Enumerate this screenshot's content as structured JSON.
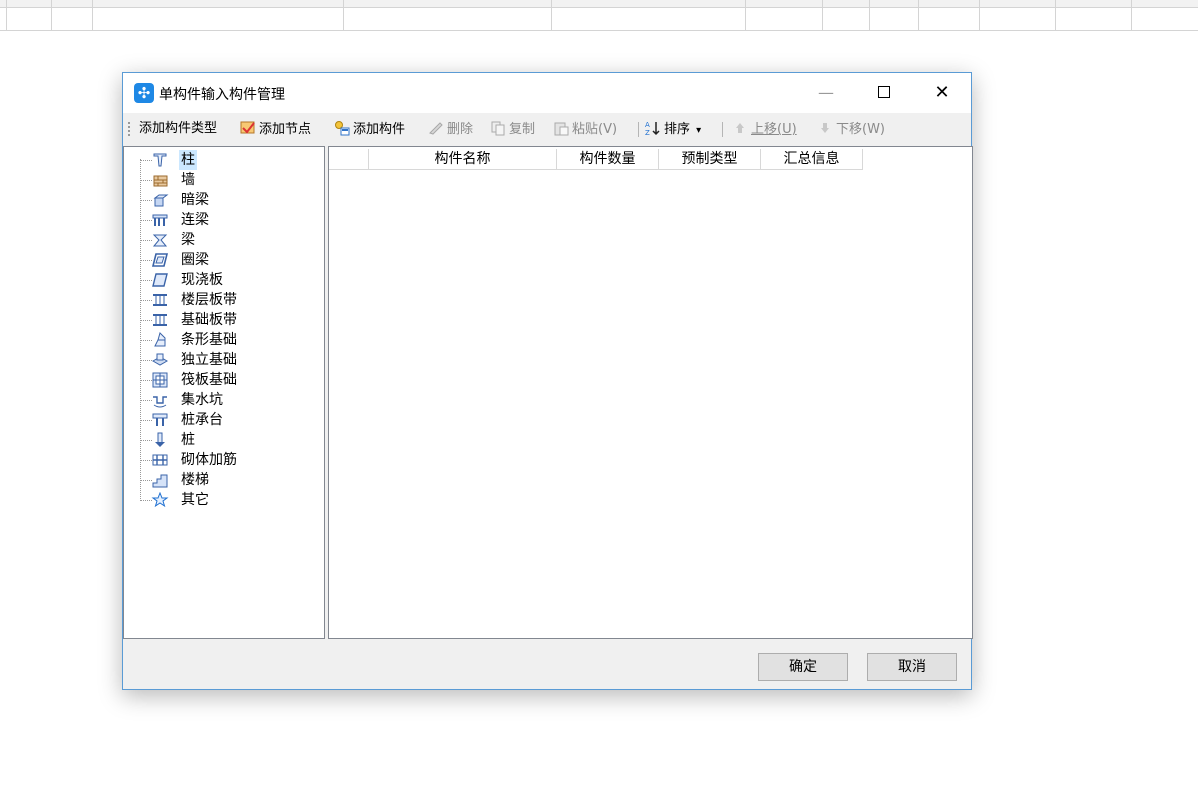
{
  "window": {
    "title": "单构件输入构件管理",
    "controls": {
      "minimize": "—",
      "close": "✕"
    }
  },
  "toolbar": {
    "add_type": "添加构件类型",
    "add_node": "添加节点",
    "add_component": "添加构件",
    "delete": "删除",
    "copy": "复制",
    "paste": "粘贴(V)",
    "sort": "排序",
    "sort_arrow": "▾",
    "move_up": "上移(U)",
    "move_down": "下移(W)"
  },
  "tree": {
    "items": [
      {
        "label": "柱",
        "icon": "column-icon",
        "selected": true
      },
      {
        "label": "墙",
        "icon": "wall-icon"
      },
      {
        "label": "暗梁",
        "icon": "hidden-beam-icon"
      },
      {
        "label": "连梁",
        "icon": "coupling-beam-icon"
      },
      {
        "label": "梁",
        "icon": "beam-icon"
      },
      {
        "label": "圈梁",
        "icon": "ring-beam-icon"
      },
      {
        "label": "现浇板",
        "icon": "cast-slab-icon"
      },
      {
        "label": "楼层板带",
        "icon": "floor-strip-icon"
      },
      {
        "label": "基础板带",
        "icon": "foundation-strip-icon"
      },
      {
        "label": "条形基础",
        "icon": "strip-foundation-icon"
      },
      {
        "label": "独立基础",
        "icon": "isolated-foundation-icon"
      },
      {
        "label": "筏板基础",
        "icon": "raft-foundation-icon"
      },
      {
        "label": "集水坑",
        "icon": "sump-pit-icon"
      },
      {
        "label": "桩承台",
        "icon": "pile-cap-icon"
      },
      {
        "label": "桩",
        "icon": "pile-icon"
      },
      {
        "label": "砌体加筋",
        "icon": "masonry-rebar-icon"
      },
      {
        "label": "楼梯",
        "icon": "stair-icon"
      },
      {
        "label": "其它",
        "icon": "star-icon"
      }
    ]
  },
  "table": {
    "columns": [
      "构件名称",
      "构件数量",
      "预制类型",
      "汇总信息"
    ]
  },
  "footer": {
    "ok": "确定",
    "cancel": "取消"
  },
  "colors": {
    "accent": "#1e88e5",
    "border": "#5a9bd5",
    "selection": "#cce8ff"
  }
}
